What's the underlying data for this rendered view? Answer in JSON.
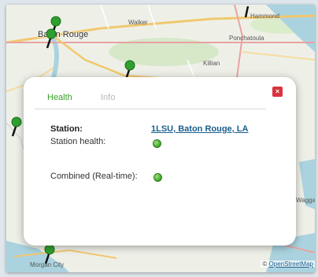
{
  "map": {
    "labels": {
      "baton_rouge": "Baton Rouge",
      "walker": "Walker",
      "hammond": "Hammond",
      "ponchatoula": "Ponchatoula",
      "killian": "Killian",
      "morgan_city": "Morgan City",
      "waggaman": "Wagga"
    },
    "attribution_symbol": "©",
    "attribution_link": "OpenStreetMap"
  },
  "popup": {
    "tabs": {
      "health": "Health",
      "info": "Info"
    },
    "close_label": "×",
    "station_label": "Station:",
    "station_value": "1LSU, Baton Rouge, LA",
    "health_label": "Station health:",
    "combined_label": "Combined (Real-time):"
  },
  "colors": {
    "status_ok": "#4caf3a",
    "active_tab": "#3aa02a",
    "link": "#1a5e8c",
    "close": "#d9333f"
  }
}
